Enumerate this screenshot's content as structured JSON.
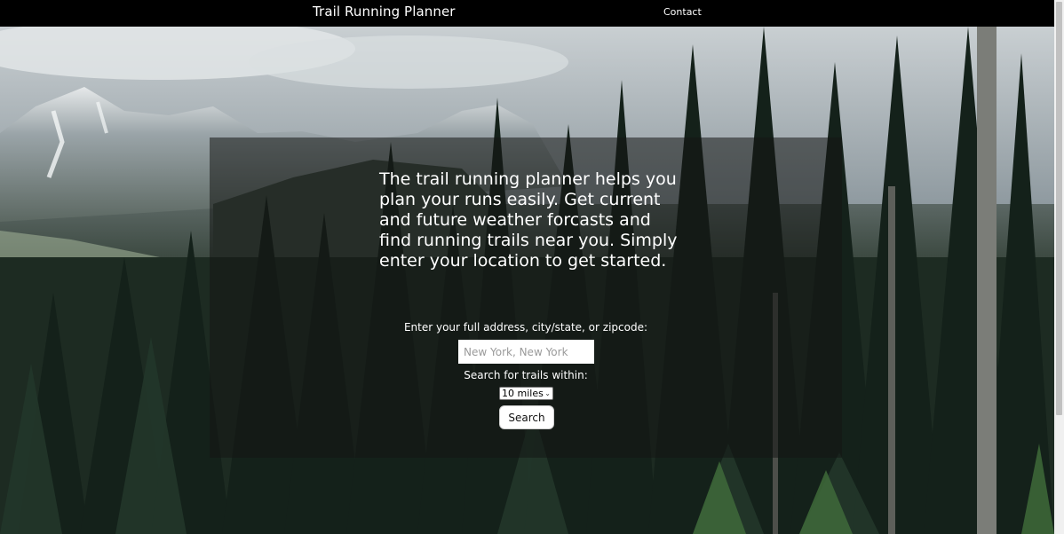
{
  "nav": {
    "brand": "Trail Running Planner",
    "contact": "Contact"
  },
  "hero": {
    "intro": "The trail running planner helps you plan your runs easily. Get current and future weather forcasts and find running trails near you. Simply enter your location to get started."
  },
  "form": {
    "address_label": "Enter your full address, city/state, or zipcode:",
    "address_placeholder": "New York, New York",
    "address_value": "",
    "radius_label": "Search for trails within:",
    "radius_selected": "10 miles",
    "search_button": "Search"
  },
  "colors": {
    "navbar_bg": "#000000",
    "panel_overlay": "rgba(20,22,20,0.55)",
    "text": "#ffffff"
  },
  "icons": {
    "select_arrow": "chevron-down-icon"
  }
}
